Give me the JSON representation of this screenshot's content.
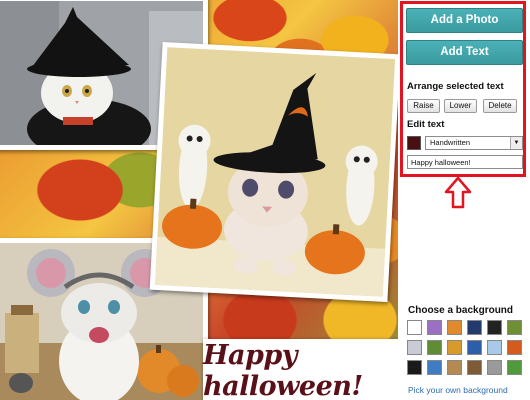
{
  "sidebar": {
    "add_photo_label": "Add a Photo",
    "add_text_label": "Add Text",
    "arrange_heading": "Arrange selected text",
    "raise_label": "Raise",
    "lower_label": "Lower",
    "delete_label": "Delete",
    "edit_heading": "Edit text",
    "text_color": "#4a0f10",
    "font_selected": "Handwritten",
    "text_value": "Happy halloween!",
    "background_heading": "Choose a background",
    "background_link": "Pick your own background",
    "backgrounds": [
      {
        "name": "white",
        "color": "#ffffff"
      },
      {
        "name": "purple-pattern",
        "color": "#9b6fc4"
      },
      {
        "name": "orange-pattern",
        "color": "#e08a2c"
      },
      {
        "name": "navy",
        "color": "#223a6e"
      },
      {
        "name": "black-dots",
        "color": "#222222"
      },
      {
        "name": "green",
        "color": "#6f8f35"
      },
      {
        "name": "tile-pattern",
        "color": "#c9ccd6"
      },
      {
        "name": "green-swirl",
        "color": "#5f8c34"
      },
      {
        "name": "orange-gold",
        "color": "#d89a2b"
      },
      {
        "name": "blue",
        "color": "#2e5ea8"
      },
      {
        "name": "light-blue",
        "color": "#a9c9e8"
      },
      {
        "name": "autumn-leaves",
        "color": "#d45a1e"
      },
      {
        "name": "black",
        "color": "#1a1a1a"
      },
      {
        "name": "blue-water",
        "color": "#3f7cc1"
      },
      {
        "name": "wood",
        "color": "#b58a52"
      },
      {
        "name": "brown-pattern",
        "color": "#7e5a35"
      },
      {
        "name": "gray",
        "color": "#9a9a9a"
      },
      {
        "name": "green-field",
        "color": "#4f9b3c"
      }
    ]
  },
  "canvas": {
    "caption_text": "Happy halloween!"
  },
  "colors": {
    "accent": "#3fa3a8",
    "highlight_border": "#e0151f"
  }
}
